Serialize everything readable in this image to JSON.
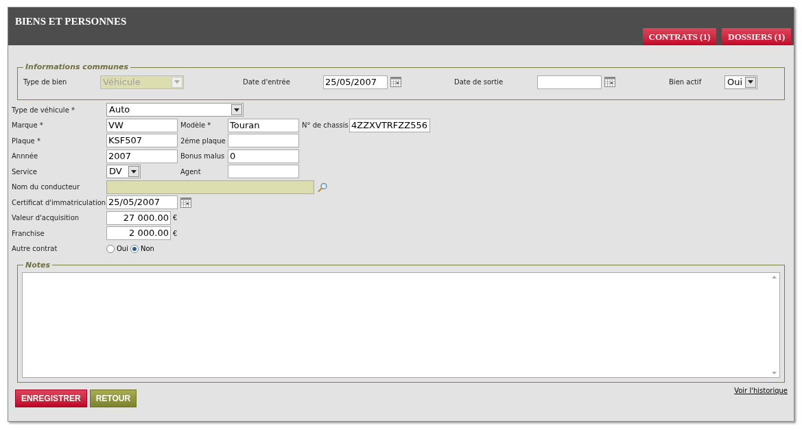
{
  "header": {
    "title": "BIENS ET PERSONNES",
    "tabs": [
      {
        "label": "CONTRATS (1)"
      },
      {
        "label": "DOSSIERS (1)"
      }
    ]
  },
  "common": {
    "legend": "Informations communes",
    "fields": [
      {
        "label": "Type de bien",
        "kind": "select",
        "value": "Véhicule",
        "disabled": true
      },
      {
        "label": "Date d'entrée",
        "kind": "date",
        "value": "25/05/2007"
      },
      {
        "label": "Date de sortie",
        "kind": "date"
      },
      {
        "label": "Bien actif",
        "kind": "select",
        "value": "Oui",
        "disabled": false
      }
    ]
  },
  "vehicle": {
    "rows": [
      [
        {
          "label": "Type de véhicule *",
          "kind": "wide-select",
          "value": "Auto"
        }
      ],
      [
        {
          "label": "Marque *",
          "kind": "text",
          "value": "VW"
        },
        {
          "label": "Modèle *",
          "kind": "text",
          "value": "Touran"
        },
        {
          "label": "N° de chassis",
          "kind": "text",
          "value": "4ZZXVTRFZZ556"
        }
      ],
      [
        {
          "label": "Plaque *",
          "kind": "text",
          "value": "KSF507"
        },
        {
          "label": "2éme plaque",
          "kind": "text"
        }
      ],
      [
        {
          "label": "Annnée",
          "kind": "text",
          "value": "2007"
        },
        {
          "label": "Bonus malus",
          "kind": "text",
          "value": "0"
        }
      ],
      [
        {
          "label": "Service",
          "kind": "small-select",
          "value": "DV"
        },
        {
          "label": "Agent",
          "kind": "text"
        }
      ],
      [
        {
          "label": "Nom du conducteur",
          "kind": "lookup",
          "disabled": true
        }
      ],
      [
        {
          "label": "Certificat d'immatriculation",
          "kind": "date",
          "value": "25/05/2007"
        }
      ],
      [
        {
          "label": "Valeur d'acquisition",
          "kind": "amount",
          "value": "27 000.00",
          "unit": "€"
        }
      ],
      [
        {
          "label": "Franchise",
          "kind": "amount",
          "value": "2 000.00",
          "unit": "€"
        }
      ],
      [
        {
          "label": "Autre contrat",
          "kind": "radio",
          "options": [
            {
              "label": "Oui",
              "selected": false
            },
            {
              "label": "Non",
              "selected": true
            }
          ]
        }
      ]
    ]
  },
  "notes": {
    "legend": "Notes"
  },
  "history_link": "Voir l'historique",
  "buttons": [
    {
      "label": "ENREGISTRER",
      "kind": "primary"
    },
    {
      "label": "RETOUR",
      "kind": "secondary"
    }
  ]
}
